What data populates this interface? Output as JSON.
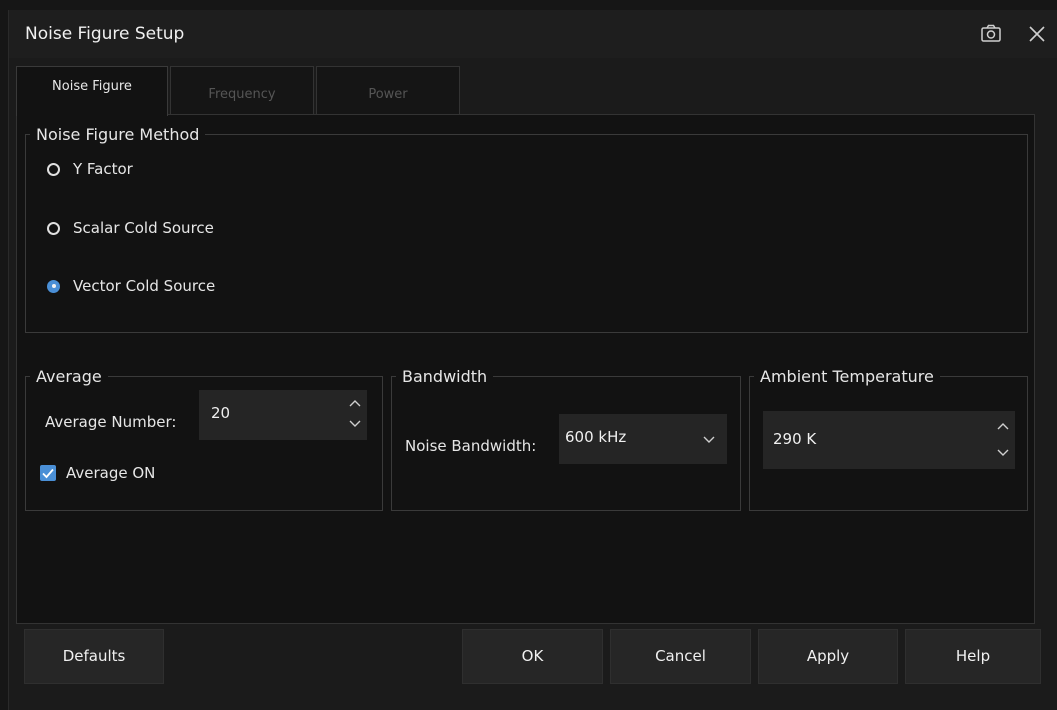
{
  "window": {
    "title": "Noise Figure Setup"
  },
  "tabs": [
    {
      "label": "Noise Figure",
      "active": true
    },
    {
      "label": "Frequency",
      "active": false
    },
    {
      "label": "Power",
      "active": false
    }
  ],
  "method": {
    "legend": "Noise Figure Method",
    "options": [
      {
        "label": "Y Factor",
        "selected": false
      },
      {
        "label": "Scalar Cold Source",
        "selected": false
      },
      {
        "label": "Vector Cold Source",
        "selected": true
      }
    ]
  },
  "average": {
    "legend": "Average",
    "number_label": "Average Number:",
    "number_value": "20",
    "on_label": "Average ON",
    "on_checked": true
  },
  "bandwidth": {
    "legend": "Bandwidth",
    "label": "Noise Bandwidth:",
    "value": "600 kHz"
  },
  "temperature": {
    "legend": "Ambient Temperature",
    "value": "290 K"
  },
  "buttons": {
    "defaults": "Defaults",
    "ok": "OK",
    "cancel": "Cancel",
    "apply": "Apply",
    "help": "Help"
  },
  "colors": {
    "accent": "#4a8fd6",
    "background": "#121212"
  }
}
